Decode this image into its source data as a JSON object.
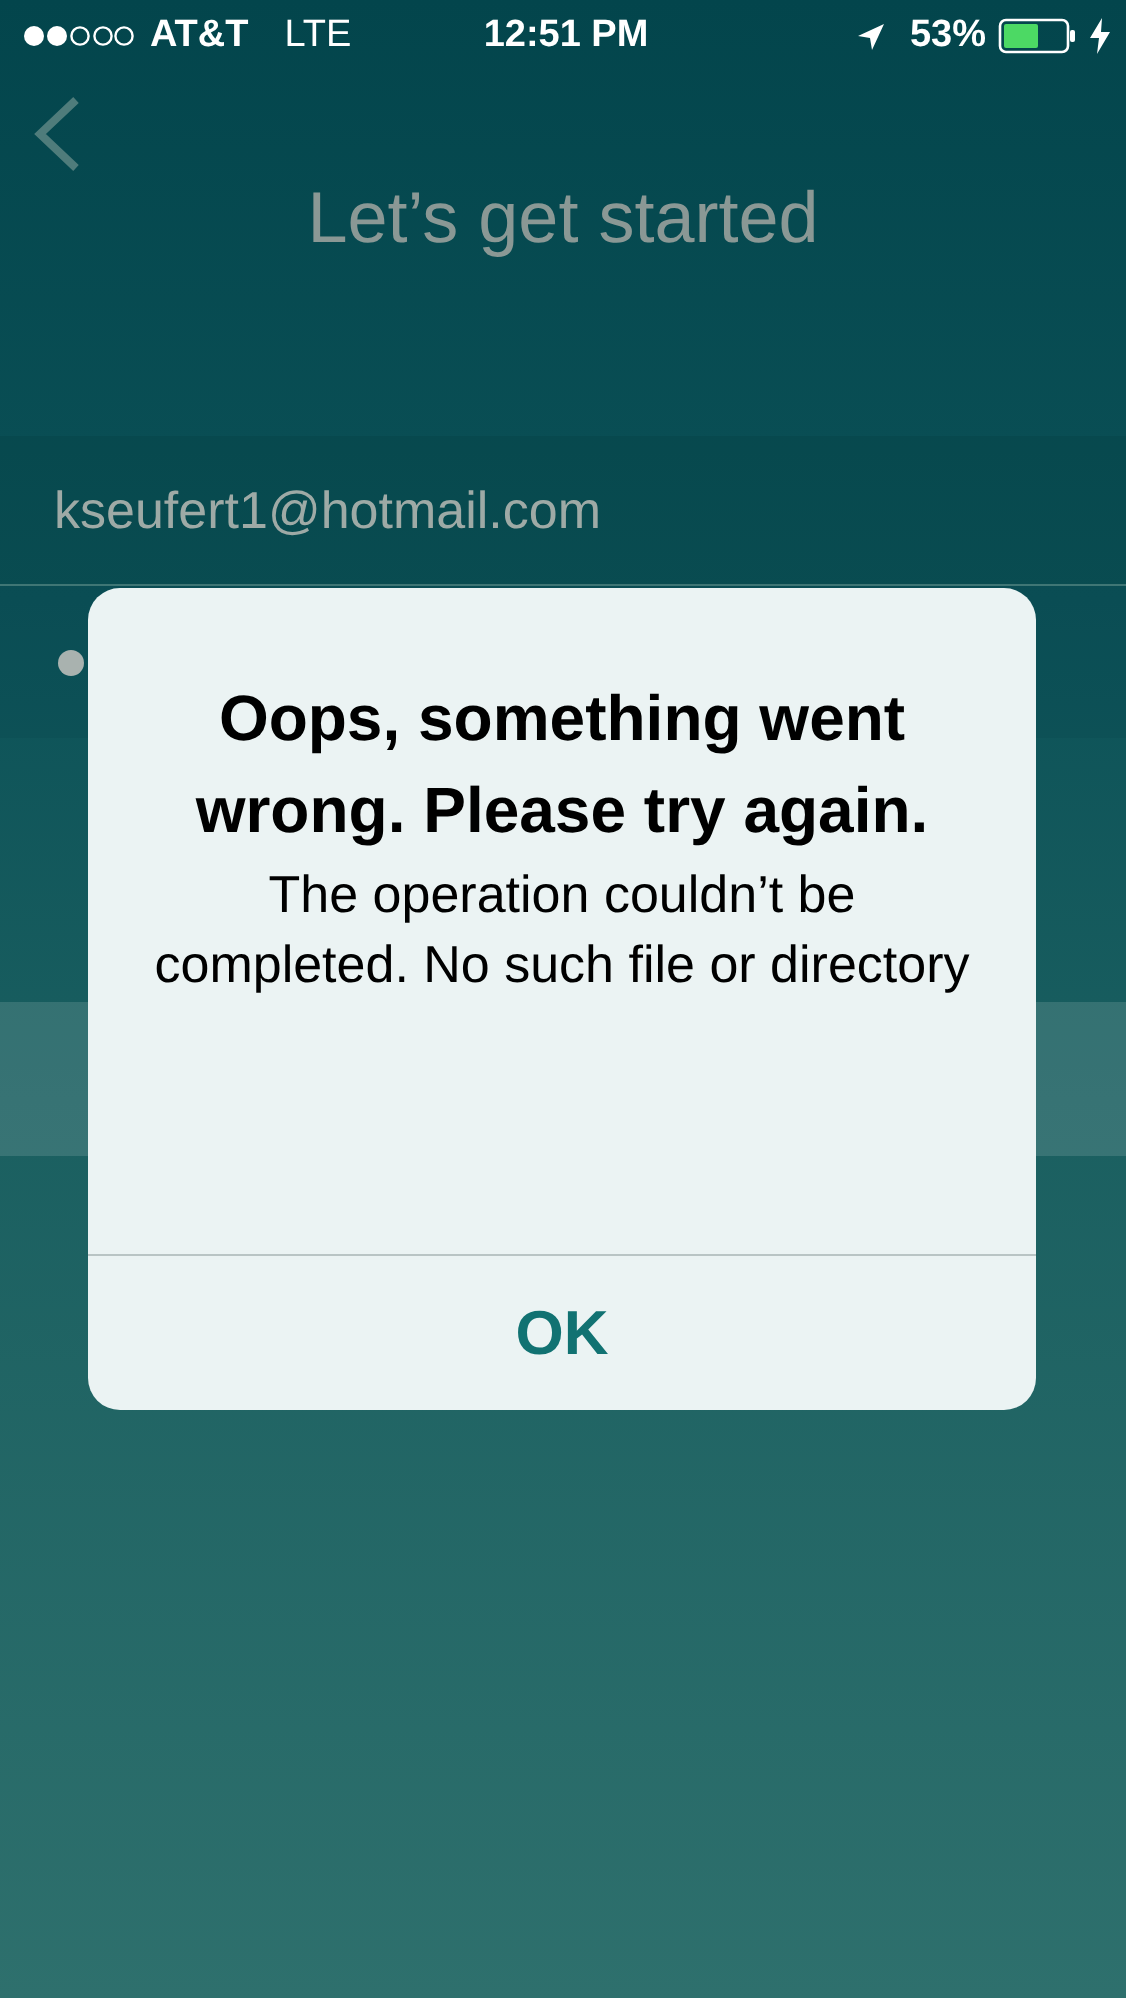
{
  "status_bar": {
    "carrier": "AT&T",
    "network": "LTE",
    "time": "12:51 PM",
    "battery": "53%"
  },
  "header": {
    "title": "Let’s get started"
  },
  "form": {
    "email": {
      "value": "kseufert1@hotmail.com"
    }
  },
  "alert": {
    "title": "Oops, something went wrong. Please try again.",
    "message": "The operation couldn’t be completed. No such file or directory",
    "buttons": [
      "OK"
    ]
  }
}
